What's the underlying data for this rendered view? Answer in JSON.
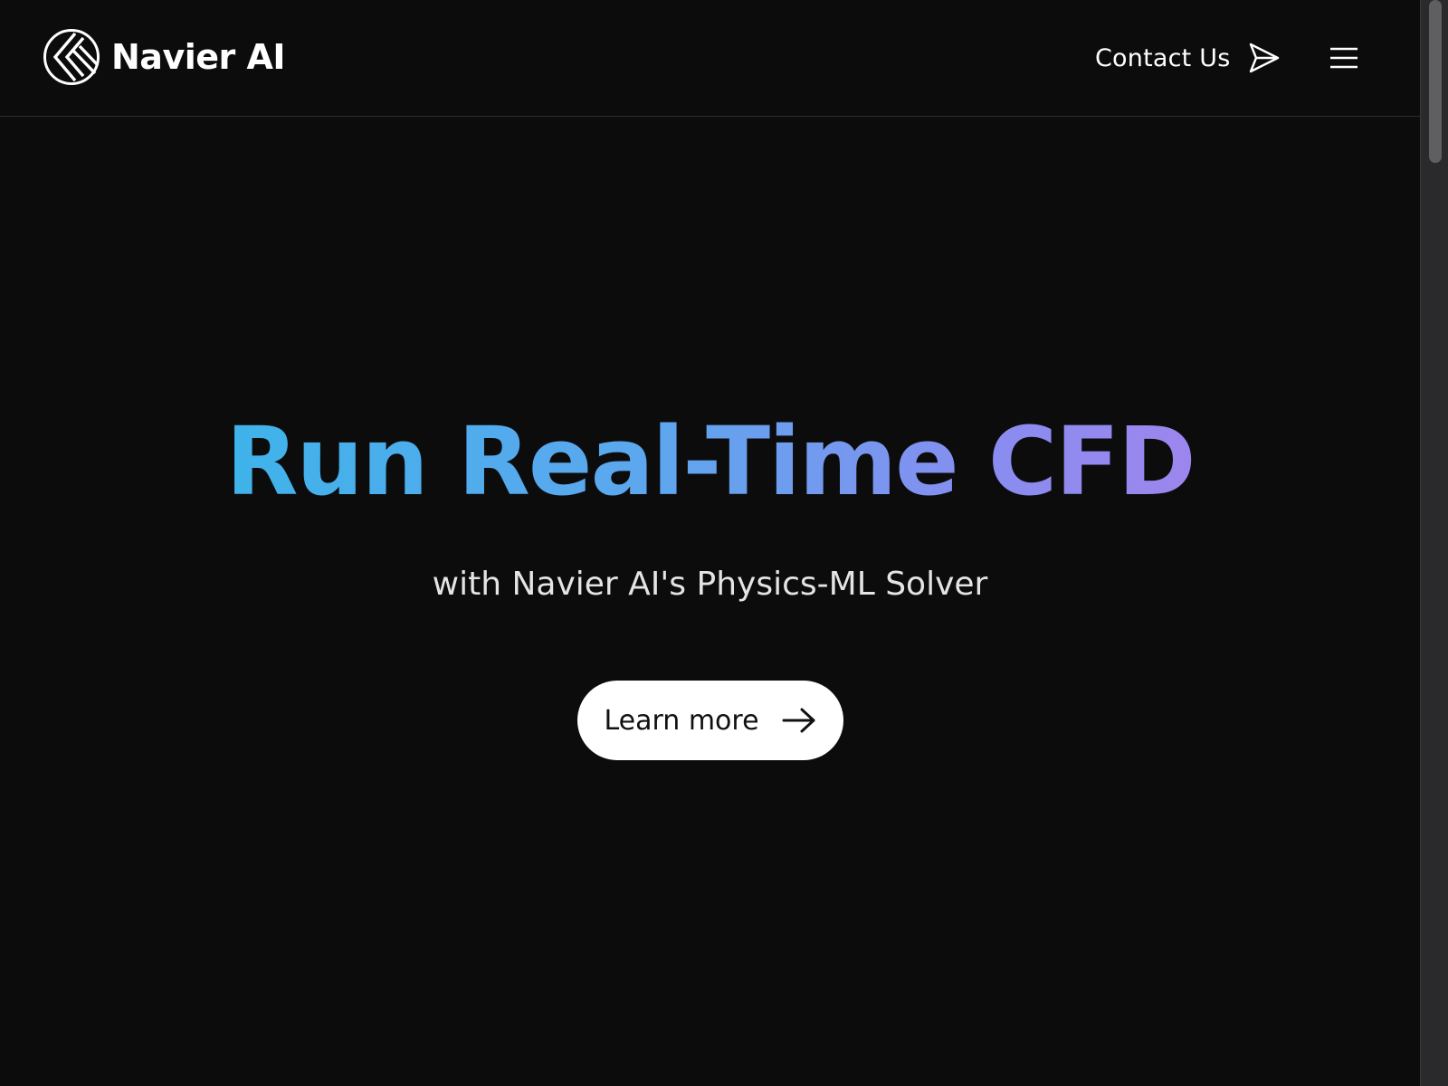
{
  "header": {
    "brand_name": "Navier AI",
    "brand_icon": "navier-logo-icon",
    "contact_label": "Contact Us",
    "contact_icon": "send-icon",
    "menu_icon": "hamburger-menu-icon"
  },
  "hero": {
    "title": "Run Real-Time CFD",
    "subtitle": "with Navier AI's Physics-ML Solver",
    "cta_label": "Learn more",
    "cta_icon": "arrow-right-icon"
  },
  "colors": {
    "background": "#0c0c0d",
    "gradient_start": "#3fb3ea",
    "gradient_end": "#9d86ee",
    "cta_background": "#ffffff",
    "cta_text": "#111111"
  }
}
